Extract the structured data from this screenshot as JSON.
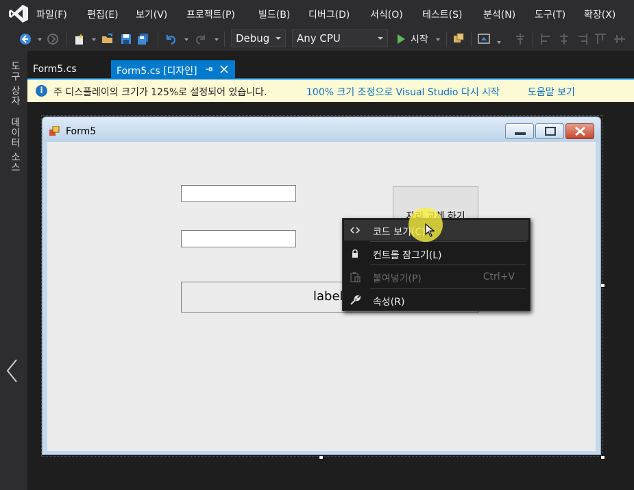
{
  "menubar": {
    "items": [
      "파일(F)",
      "편집(E)",
      "보기(V)",
      "프로젝트(P)",
      "빌드(B)",
      "디버그(D)",
      "서식(O)",
      "테스트(S)",
      "분석(N)",
      "도구(T)",
      "확장(X)"
    ]
  },
  "toolbar": {
    "configuration": "Debug",
    "platform": "Any CPU",
    "start_label": "시작"
  },
  "side_tabs": [
    "도구 상자",
    "데이터 소스"
  ],
  "doc_tabs": [
    {
      "label": "Form5.cs",
      "active": false
    },
    {
      "label": "Form5.cs [디자인]",
      "active": true
    }
  ],
  "infobar": {
    "message": "주 디스플레이의 크기가 125%로 설정되어 있습니다.",
    "restart_link": "100% 크기 조정으로 Visual Studio 다시 시작",
    "help_link": "도움말 보기"
  },
  "form": {
    "title": "Form5",
    "button_text": "자리 교체 하기",
    "label_text": "label1"
  },
  "context_menu": {
    "items": [
      {
        "label": "코드 보기(C)",
        "icon": "code-icon",
        "shortcut": "",
        "enabled": true,
        "selected": true
      },
      {
        "label": "컨트롤 잠그기(L)",
        "icon": "lock-icon",
        "shortcut": "",
        "enabled": true,
        "selected": false
      },
      {
        "label": "붙여넣기(P)",
        "icon": "paste-icon",
        "shortcut": "Ctrl+V",
        "enabled": false,
        "selected": false
      },
      {
        "label": "속성(R)",
        "icon": "wrench-icon",
        "shortcut": "",
        "enabled": true,
        "selected": false
      }
    ]
  },
  "colors": {
    "accent": "#007acc",
    "chrome": "#2d2d30",
    "infobar": "#fdfbd5",
    "link": "#0e70c0",
    "cursor_highlight": "#faf03c"
  }
}
